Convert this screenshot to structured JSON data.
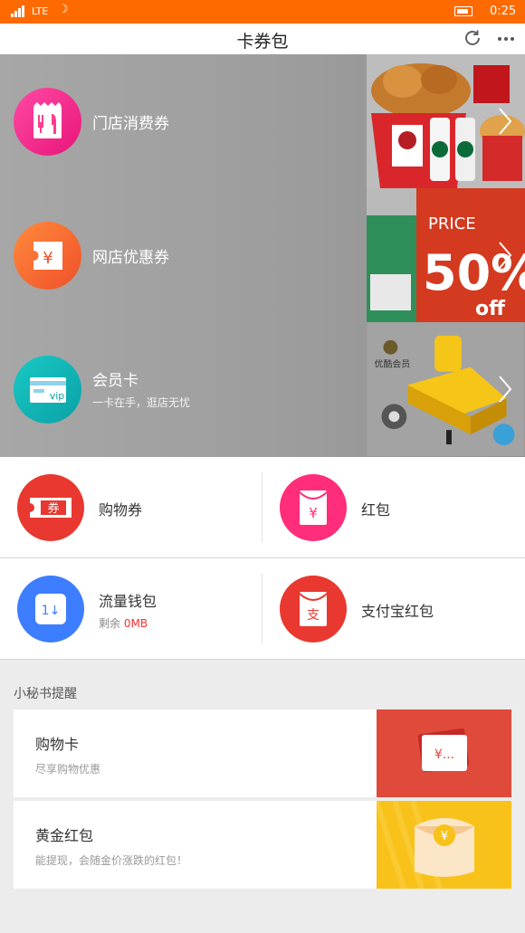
{
  "status": {
    "network": "LTE",
    "time": "0:25"
  },
  "header": {
    "title": "卡券包"
  },
  "banners": [
    {
      "label": "门店消费券",
      "sub": ""
    },
    {
      "label": "网店优惠券",
      "sub": "",
      "art_text": "PRICE",
      "art_big": "50%",
      "art_off": "off"
    },
    {
      "label": "会员卡",
      "sub": "一卡在手，逛店无忧",
      "art_text": "优酷会员"
    }
  ],
  "grid": [
    {
      "label": "购物券",
      "icon_char": "券"
    },
    {
      "label": "红包",
      "icon_char": "¥"
    },
    {
      "label": "流量钱包",
      "sub_prefix": "剩余 ",
      "sub_value": "0MB",
      "icon_char": "1↓"
    },
    {
      "label": "支付宝红包",
      "icon_char": "支"
    }
  ],
  "section": {
    "title": "小秘书提醒"
  },
  "cards": [
    {
      "title": "购物卡",
      "sub": "尽享购物优惠",
      "thumb_text": "¥..."
    },
    {
      "title": "黄金红包",
      "sub": "能提现，会随金价涨跌的红包！",
      "thumb_text": "¥"
    }
  ],
  "colors": {
    "brand": "#ff6a00",
    "red": "#e8382f",
    "pink": "#ff2d7a",
    "blue": "#3d7dff"
  }
}
